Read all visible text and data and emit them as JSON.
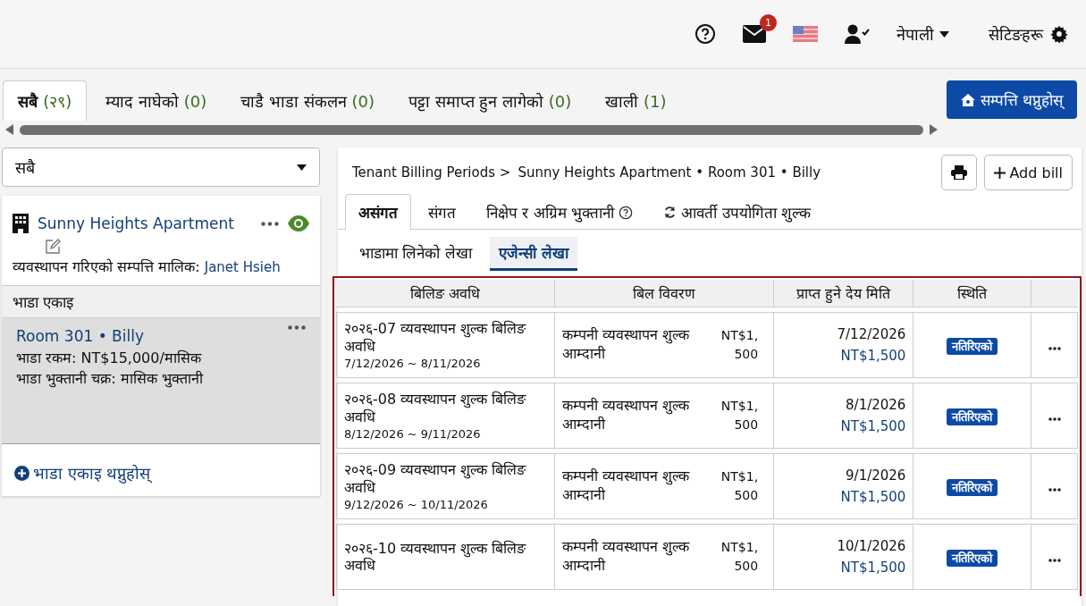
{
  "header": {
    "mail_count": "1",
    "language": "नेपाली",
    "settings": "सेटिङहरू"
  },
  "property_tabs": [
    {
      "label": "सबै",
      "count": "(२९)",
      "selected": true
    },
    {
      "label": "म्याद नाघेको",
      "count": "(0)",
      "selected": false
    },
    {
      "label": "चाडै भाडा संकलन",
      "count": "(0)",
      "selected": false
    },
    {
      "label": "पट्टा समाप्त हुन लागेको",
      "count": "(0)",
      "selected": false
    },
    {
      "label": "खाली",
      "count": "(1)",
      "selected": false
    }
  ],
  "add_property_button": "सम्पत्ति थप्नुहोस्",
  "filter": {
    "value": "सबै"
  },
  "property": {
    "name": "Sunny Heights Apartment",
    "owner_label": "व्यवस्थापन गरिएको सम्पत्ति मालिक:",
    "owner": "Janet Hsieh",
    "units_heading": "भाडा एकाइ",
    "units": [
      {
        "title": "Room 301 • Billy",
        "rent": "भाडा रकम: NT$15,000/मासिक",
        "cycle": "भाडा भुक्तानी चक्र: मासिक भुक्तानी",
        "selected": true
      }
    ],
    "add_unit": "भाडा एकाइ थप्नुहोस्"
  },
  "breadcrumb": [
    {
      "label": "Tenant Billing Periods >"
    },
    {
      "label": "Sunny Heights Apartment • Room 301 • Billy"
    }
  ],
  "add_bill_button": "Add bill",
  "bill_tabs": [
    {
      "label": "असंगत",
      "selected": true,
      "kind": "plain"
    },
    {
      "label": "संगत",
      "selected": false,
      "kind": "plain"
    },
    {
      "label": "निक्षेप र अग्रिम भुक्तानी",
      "selected": false,
      "kind": "help"
    },
    {
      "label": "आवर्ती उपयोगिता शुल्क",
      "selected": false,
      "kind": "refresh"
    }
  ],
  "ledger_tabs": [
    {
      "label": "भाडामा लिनेको लेखा",
      "selected": false
    },
    {
      "label": "एजेन्सी लेखा",
      "selected": true
    }
  ],
  "table": {
    "columns": [
      "बिलिङ अवधि",
      "बिल विवरण",
      "प्राप्त हुने देय मिति",
      "स्थिति"
    ],
    "rows": [
      {
        "period": "२०२६-07 व्यवस्थापन शुल्क बिलिङ अवधि",
        "range": "7/12/2026 ~ 8/11/2026",
        "item": "कम्पनी व्यवस्थापन शुल्क आम्दानी",
        "amount": "NT$1,500",
        "due_date": "7/12/2026",
        "due_amount": "NT$1,500",
        "status": "नतिरिएको"
      },
      {
        "period": "२०२६-08 व्यवस्थापन शुल्क बिलिङ अवधि",
        "range": "8/12/2026 ~ 9/11/2026",
        "item": "कम्पनी व्यवस्थापन शुल्क आम्दानी",
        "amount": "NT$1,500",
        "due_date": "8/1/2026",
        "due_amount": "NT$1,500",
        "status": "नतिरिएको"
      },
      {
        "period": "२०२६-09 व्यवस्थापन शुल्क बिलिङ अवधि",
        "range": "9/12/2026 ~ 10/11/2026",
        "item": "कम्पनी व्यवस्थापन शुल्क आम्दानी",
        "amount": "NT$1,500",
        "due_date": "9/1/2026",
        "due_amount": "NT$1,500",
        "status": "नतिरिएको"
      },
      {
        "period": "२०२६-10 व्यवस्थापन शुल्क बिलिङ अवधि",
        "item": "कम्पनी व्यवस्थापन शुल्क आम्दानी",
        "amount": "NT$1,500",
        "due_date": "10/1/2026",
        "due_amount": "NT$1,500",
        "status": "नतिरिएको"
      }
    ]
  }
}
